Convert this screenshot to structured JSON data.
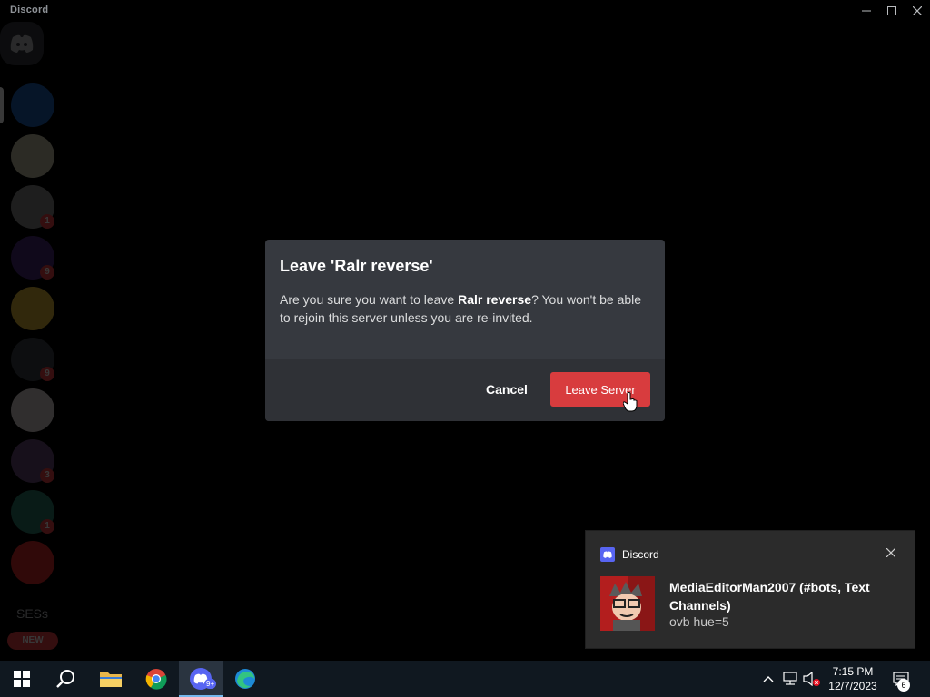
{
  "window": {
    "title": "Discord"
  },
  "rail": {
    "badges": [
      "1",
      "9",
      "9",
      "3",
      "1"
    ],
    "ses_label": "SESs",
    "new_label": "NEW"
  },
  "modal": {
    "title": "Leave 'Ralr reverse'",
    "body_prefix": "Are you sure you want to leave ",
    "server_name": "Ralr reverse",
    "body_suffix": "? You won't be able to rejoin this server unless you are re-invited.",
    "cancel_label": "Cancel",
    "leave_label": "Leave Server"
  },
  "toast": {
    "app_name": "Discord",
    "title": "MediaEditorMan2007 (#bots, Text Channels)",
    "message": "ovb hue=5"
  },
  "taskbar": {
    "time": "7:15 PM",
    "date": "12/7/2023",
    "discord_badge": "9+",
    "notification_count": "6"
  },
  "colors": {
    "danger": "#d83c3e",
    "modal_bg": "#36393f",
    "footer_bg": "#2f3136",
    "blurple": "#5865f2"
  }
}
